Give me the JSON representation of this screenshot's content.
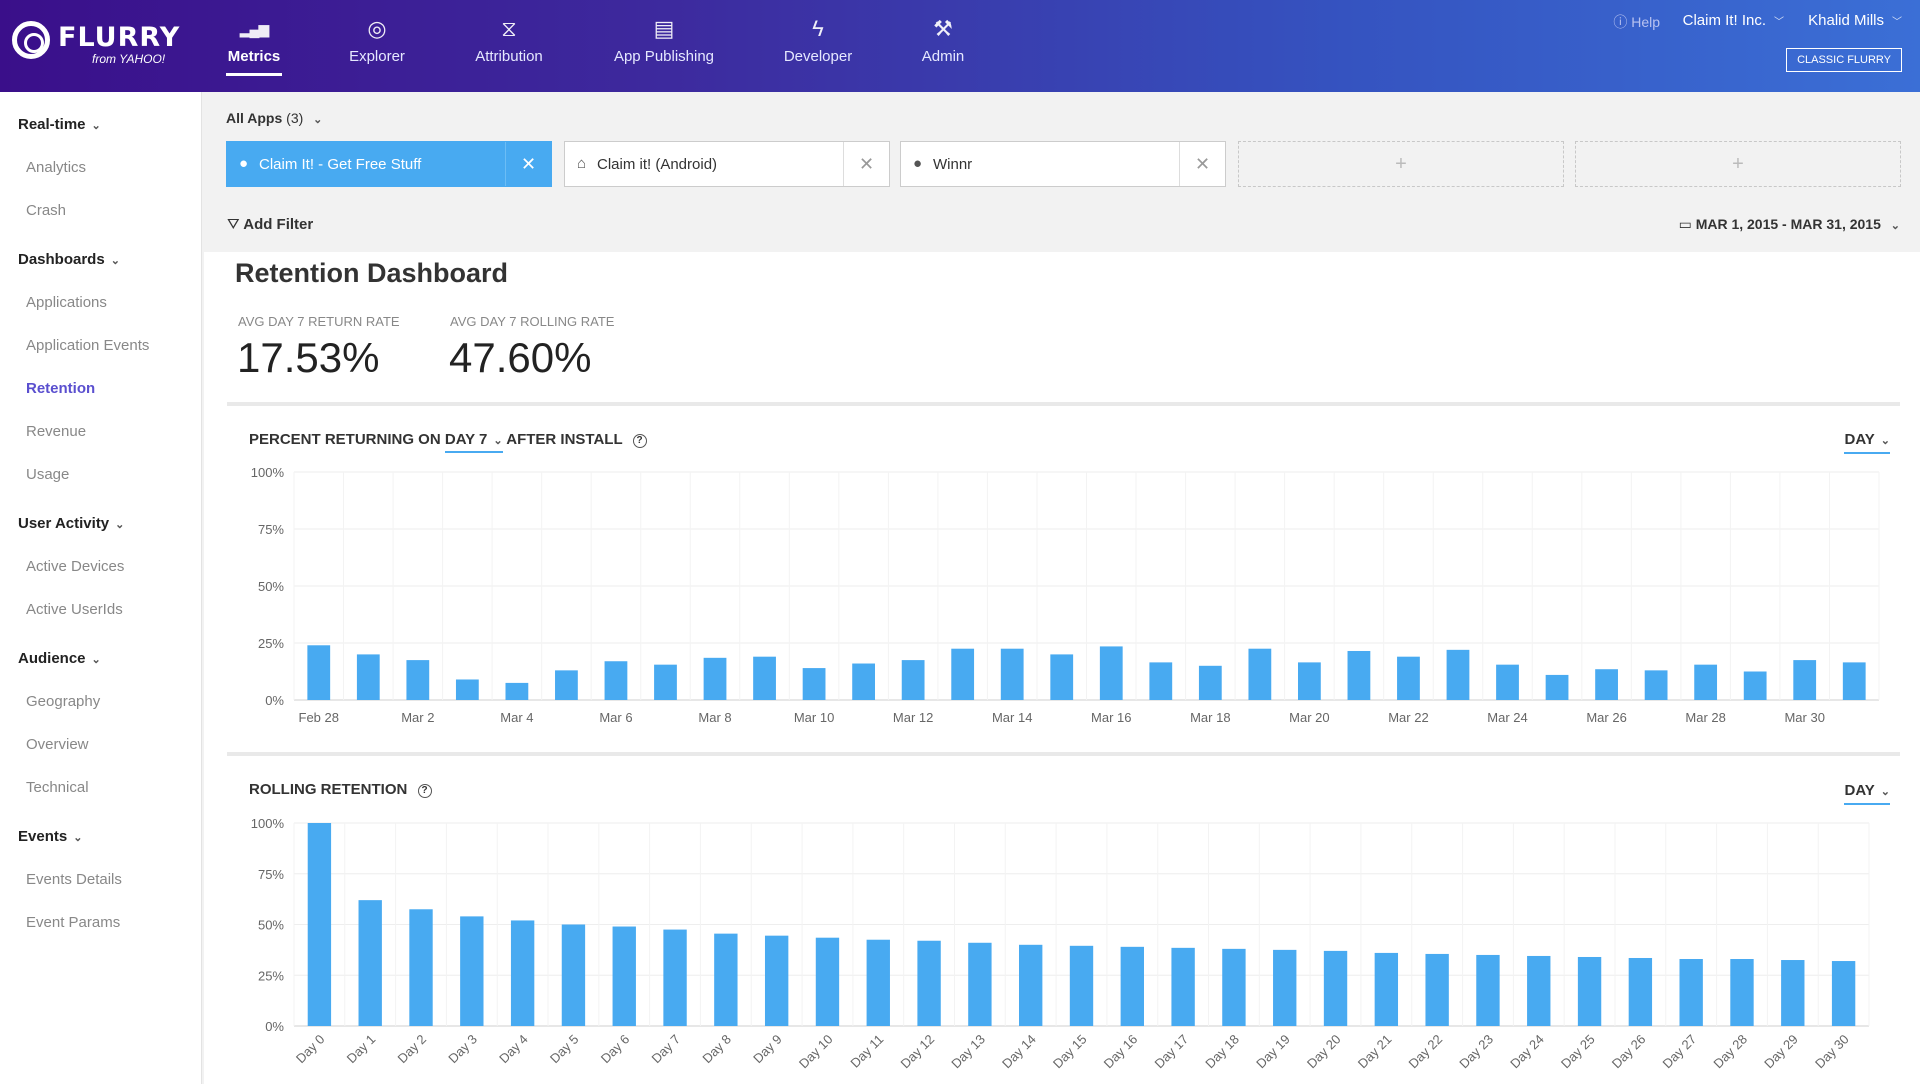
{
  "brand": {
    "name": "FLURRY",
    "sub": "from YAHOO!"
  },
  "nav": [
    {
      "label": "Metrics",
      "icon": "bar-chart-icon",
      "active": true
    },
    {
      "label": "Explorer",
      "icon": "compass-icon"
    },
    {
      "label": "Attribution",
      "icon": "funnel-icon"
    },
    {
      "label": "App Publishing",
      "icon": "publishing-icon"
    },
    {
      "label": "Developer",
      "icon": "lightning-icon"
    },
    {
      "label": "Admin",
      "icon": "wrench-icon"
    }
  ],
  "topright": {
    "help": "Help",
    "org": "Claim It! Inc.",
    "user": "Khalid Mills",
    "classic": "CLASSIC FLURRY"
  },
  "sidebar": {
    "sections": [
      {
        "title": "Real-time",
        "items": [
          "Analytics",
          "Crash"
        ]
      },
      {
        "title": "Dashboards",
        "items": [
          "Applications",
          "Application Events",
          "Retention",
          "Revenue",
          "Usage"
        ]
      },
      {
        "title": "User Activity",
        "items": [
          "Active Devices",
          "Active UserIds"
        ]
      },
      {
        "title": "Audience",
        "items": [
          "Geography",
          "Overview",
          "Technical"
        ]
      },
      {
        "title": "Events",
        "items": [
          "Events Details",
          "Event Params"
        ]
      }
    ],
    "active": "Retention"
  },
  "apps": {
    "label": "All Apps",
    "count": "(3)",
    "selected": [
      {
        "name": "Claim It! - Get Free Stuff",
        "os": "apple-icon",
        "active": true
      },
      {
        "name": "Claim it! (Android)",
        "os": "android-icon"
      },
      {
        "name": "Winnr",
        "os": "apple-icon"
      }
    ],
    "empty_slot": "+"
  },
  "filter": {
    "add": "Add Filter"
  },
  "date_range": "MAR 1, 2015 - MAR 31, 2015",
  "dashboard": {
    "title": "Retention Dashboard",
    "stats": [
      {
        "label": "AVG DAY 7 RETURN RATE",
        "value": "17.53%"
      },
      {
        "label": "AVG DAY 7 ROLLING RATE",
        "value": "47.60%"
      }
    ]
  },
  "chart1_header": {
    "prefix": "PERCENT RETURNING ON",
    "day": "DAY 7",
    "suffix": "AFTER INSTALL",
    "granularity": "DAY"
  },
  "chart2_header": {
    "title": "ROLLING RETENTION",
    "granularity": "DAY"
  },
  "chart_data": [
    {
      "type": "bar",
      "title": "PERCENT RETURNING ON DAY 7 AFTER INSTALL",
      "x": [
        "Feb 28",
        "Mar 1",
        "Mar 2",
        "Mar 3",
        "Mar 4",
        "Mar 5",
        "Mar 6",
        "Mar 7",
        "Mar 8",
        "Mar 9",
        "Mar 10",
        "Mar 11",
        "Mar 12",
        "Mar 13",
        "Mar 14",
        "Mar 15",
        "Mar 16",
        "Mar 17",
        "Mar 18",
        "Mar 19",
        "Mar 20",
        "Mar 21",
        "Mar 22",
        "Mar 23",
        "Mar 24",
        "Mar 25",
        "Mar 26",
        "Mar 27",
        "Mar 28",
        "Mar 29",
        "Mar 30",
        "Mar 31"
      ],
      "xtick_labels": [
        "Feb 28",
        "Mar 2",
        "Mar 4",
        "Mar 6",
        "Mar 8",
        "Mar 10",
        "Mar 12",
        "Mar 14",
        "Mar 16",
        "Mar 18",
        "Mar 20",
        "Mar 22",
        "Mar 24",
        "Mar 26",
        "Mar 28",
        "Mar 30"
      ],
      "values": [
        24,
        20,
        17.5,
        9,
        7.5,
        13,
        17,
        15.5,
        18.5,
        19,
        14,
        16,
        17.5,
        22.5,
        22.5,
        20,
        23.5,
        16.5,
        15,
        22.5,
        16.5,
        21.5,
        19,
        22,
        15.5,
        11,
        13.5,
        13,
        15.5,
        12.5,
        17.5,
        16.5
      ],
      "ylim": [
        0,
        100
      ],
      "yticks": [
        "0%",
        "25%",
        "50%",
        "75%",
        "100%"
      ],
      "grid": true,
      "color": "#48aaf1"
    },
    {
      "type": "bar",
      "title": "ROLLING RETENTION",
      "categories": [
        "Day 0",
        "Day 1",
        "Day 2",
        "Day 3",
        "Day 4",
        "Day 5",
        "Day 6",
        "Day 7",
        "Day 8",
        "Day 9",
        "Day 10",
        "Day 11",
        "Day 12",
        "Day 13",
        "Day 14",
        "Day 15",
        "Day 16",
        "Day 17",
        "Day 18",
        "Day 19",
        "Day 20",
        "Day 21",
        "Day 22",
        "Day 23",
        "Day 24",
        "Day 25",
        "Day 26",
        "Day 27",
        "Day 28",
        "Day 29",
        "Day 30"
      ],
      "values": [
        100,
        62,
        57.5,
        54,
        52,
        50,
        49,
        47.5,
        45.5,
        44.5,
        43.5,
        42.5,
        42,
        41,
        40,
        39.5,
        39,
        38.5,
        38,
        37.5,
        37,
        36,
        35.5,
        35,
        34.5,
        34,
        33.5,
        33,
        33,
        32.5,
        32
      ],
      "ylim": [
        0,
        100
      ],
      "yticks": [
        "0%",
        "25%",
        "50%",
        "75%",
        "100%"
      ],
      "grid": true,
      "color": "#48aaf1"
    }
  ]
}
